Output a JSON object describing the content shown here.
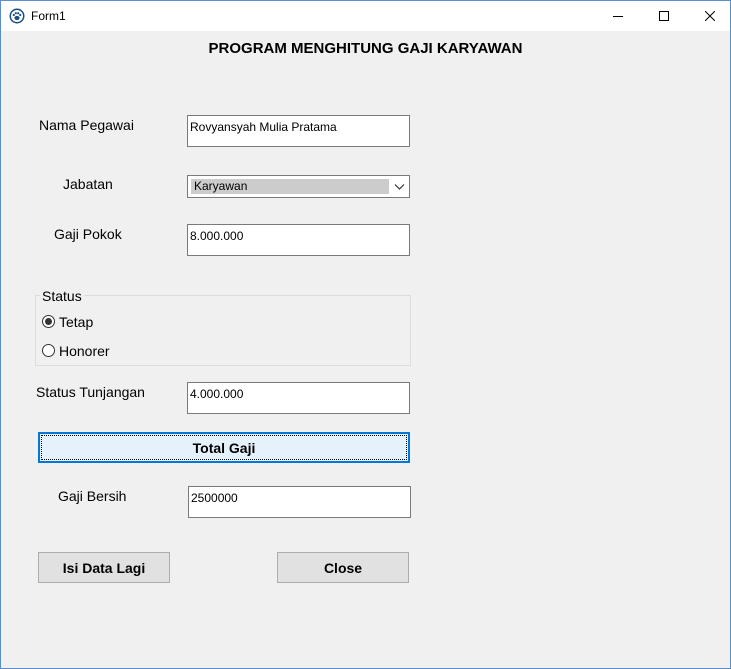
{
  "window": {
    "title": "Form1",
    "controls": {
      "minimize": "minimize-icon",
      "maximize": "maximize-icon",
      "close": "close-icon"
    }
  },
  "header": {
    "title": "PROGRAM MENGHITUNG GAJI KARYAWAN"
  },
  "form": {
    "nama_label": "Nama Pegawai",
    "nama_value": "Rovyansyah Mulia Pratama",
    "jabatan_label": "Jabatan",
    "jabatan_value": "Karyawan",
    "gaji_pokok_label": "Gaji Pokok",
    "gaji_pokok_value": "8.000.000",
    "status_group_label": "Status",
    "status_options": [
      {
        "label": "Tetap",
        "checked": true
      },
      {
        "label": "Honorer",
        "checked": false
      }
    ],
    "tunjangan_label": "Status Tunjangan",
    "tunjangan_value": "4.000.000",
    "total_button": "Total Gaji",
    "gaji_bersih_label": "Gaji Bersih",
    "gaji_bersih_value": "2500000",
    "isi_button": "Isi Data Lagi",
    "close_button": "Close"
  },
  "colors": {
    "window_bg": "#f0f0f0",
    "focus_border": "#0078d7",
    "button_bg": "#e1e1e1"
  }
}
